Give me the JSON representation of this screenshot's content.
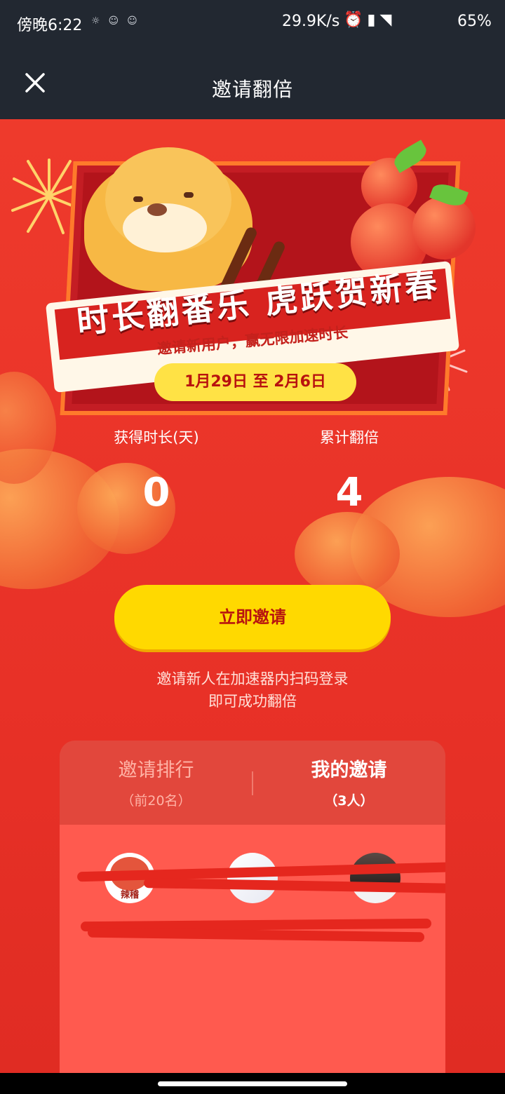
{
  "status_bar": {
    "time": "傍晚6:22",
    "network_speed": "29.9K/s",
    "battery": "65%"
  },
  "header": {
    "title": "邀请翻倍"
  },
  "banner": {
    "slogan": "时长翻番乐  虎跃贺新春",
    "subtitle": "邀请新用户，赢无限加速时长",
    "date_range": "1月29日 至 2月6日"
  },
  "stats": {
    "earned_label": "获得时长(天)",
    "earned_value": "0",
    "multiplier_label": "累计翻倍",
    "multiplier_value": "4"
  },
  "cta": {
    "label": "立即邀请"
  },
  "hint": {
    "line1": "邀请新人在加速器内扫码登录",
    "line2": "即可成功翻倍"
  },
  "tabs": [
    {
      "name": "邀请排行",
      "sub": "（前20名）",
      "active": false
    },
    {
      "name": "我的邀请",
      "sub": "（3人）",
      "active": true
    }
  ],
  "avatar_badge": "辣稽",
  "colors": {
    "header_bg": "#222831",
    "page_red": "#e8342a",
    "cta_yellow": "#ffd900",
    "panel_bg": "#ff5a4f"
  }
}
